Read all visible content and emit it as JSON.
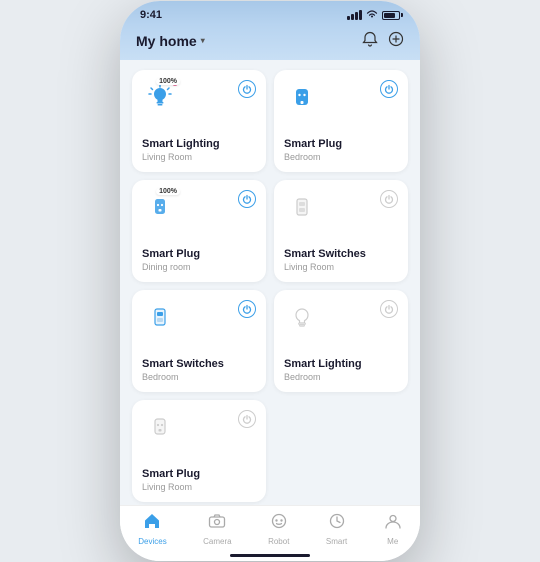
{
  "statusBar": {
    "time": "9:41"
  },
  "header": {
    "title": "My home",
    "dropdownArrow": "▼"
  },
  "devices": [
    {
      "id": "d1",
      "name": "Smart Lighting",
      "room": "Living Room",
      "icon": "lighting-active",
      "active": true,
      "percentage": "100%",
      "hasDot": true
    },
    {
      "id": "d2",
      "name": "Smart Plug",
      "room": "Bedroom",
      "icon": "plug-active",
      "active": true,
      "percentage": null,
      "hasDot": false
    },
    {
      "id": "d3",
      "name": "Smart Plug",
      "room": "Dining room",
      "icon": "plug-active2",
      "active": true,
      "percentage": "100%",
      "hasDot": false
    },
    {
      "id": "d4",
      "name": "Smart Switches",
      "room": "Living Room",
      "icon": "switch-inactive",
      "active": false,
      "percentage": null,
      "hasDot": false
    },
    {
      "id": "d5",
      "name": "Smart Switches",
      "room": "Bedroom",
      "icon": "switch-active",
      "active": true,
      "percentage": null,
      "hasDot": false
    },
    {
      "id": "d6",
      "name": "Smart Lighting",
      "room": "Bedroom",
      "icon": "lighting-inactive",
      "active": false,
      "percentage": null,
      "hasDot": false
    },
    {
      "id": "d7",
      "name": "Smart Plug",
      "room": "Living Room",
      "icon": "plug-inactive",
      "active": false,
      "percentage": null,
      "hasDot": false
    }
  ],
  "navbar": {
    "items": [
      {
        "id": "devices",
        "label": "Devices",
        "active": true
      },
      {
        "id": "camera",
        "label": "Camera",
        "active": false
      },
      {
        "id": "robot",
        "label": "Robot",
        "active": false
      },
      {
        "id": "smart",
        "label": "Smart",
        "active": false
      },
      {
        "id": "me",
        "label": "Me",
        "active": false
      }
    ]
  }
}
